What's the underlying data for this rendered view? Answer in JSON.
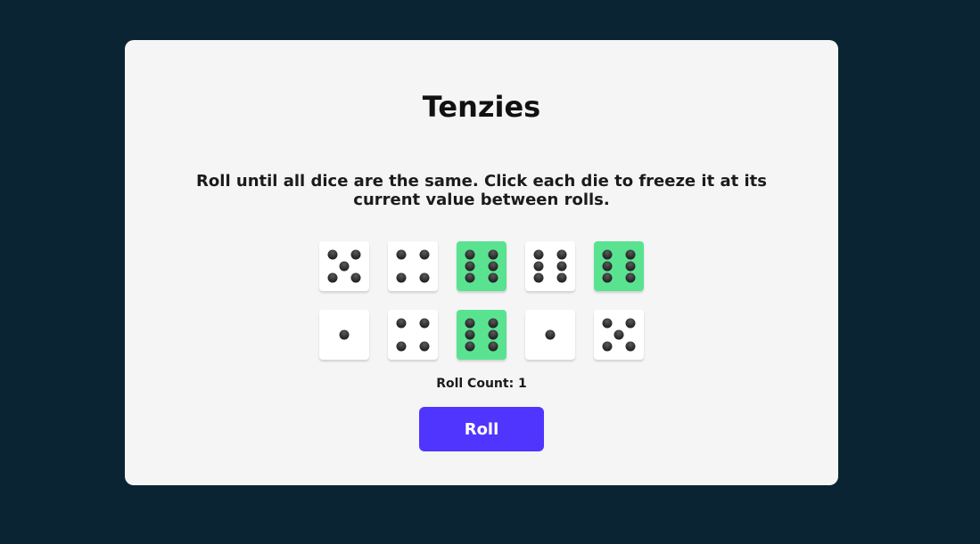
{
  "game": {
    "title": "Tenzies",
    "instructions": "Roll until all dice are the same. Click each die to freeze it at its current value between rolls.",
    "roll_count_label": "Roll Count: 1",
    "roll_button_label": "Roll"
  },
  "dice": [
    {
      "value": 5,
      "held": false
    },
    {
      "value": 4,
      "held": false
    },
    {
      "value": 6,
      "held": true
    },
    {
      "value": 6,
      "held": false
    },
    {
      "value": 6,
      "held": true
    },
    {
      "value": 1,
      "held": false
    },
    {
      "value": 4,
      "held": false
    },
    {
      "value": 6,
      "held": true
    },
    {
      "value": 1,
      "held": false
    },
    {
      "value": 5,
      "held": false
    }
  ],
  "colors": {
    "page_background": "#0b2434",
    "board_background": "#f5f5f5",
    "held_die": "#59e391",
    "die": "#ffffff",
    "button": "#5035ff"
  }
}
